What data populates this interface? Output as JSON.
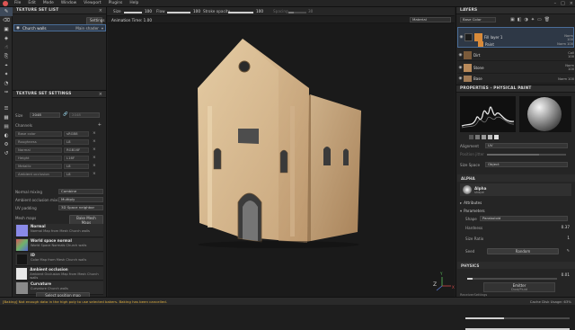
{
  "menubar": {
    "items": [
      "File",
      "Edit",
      "Mode",
      "Window",
      "Viewport",
      "Plugins",
      "Help"
    ]
  },
  "context_bar": {
    "size_label": "Size",
    "size_value": "100",
    "flow_label": "Flow",
    "flow_value": "100",
    "stroke_label": "Stroke opacity",
    "stroke_value": "100",
    "spacing_label": "Spacing",
    "spacing_value": "30"
  },
  "viewport": {
    "header_left": "Animation Time: 1.00",
    "material_mode": "Material",
    "gizmo_z": "Z",
    "gizmo_x": "X",
    "gizmo_y": "Y"
  },
  "texture_set_list": {
    "title": "TEXTURE SET LIST",
    "settings_label": "Settings",
    "item_name": "Church walls",
    "item_shader": "Main shader"
  },
  "texture_set_settings": {
    "title": "TEXTURE SET SETTINGS",
    "size_label": "Size",
    "size_value": "2048",
    "size_linked": "2048",
    "channels_label": "Channels",
    "channels": [
      {
        "name": "Base color",
        "format": "sRGB8"
      },
      {
        "name": "Roughness",
        "format": "L8"
      },
      {
        "name": "Normal",
        "format": "RGB16F"
      },
      {
        "name": "Height",
        "format": "L16F"
      },
      {
        "name": "Metallic",
        "format": "L8"
      },
      {
        "name": "Ambient occlusion",
        "format": "L8"
      }
    ],
    "normal_mixing_label": "Normal mixing",
    "normal_mixing_value": "Combine",
    "ao_mixing_label": "Ambient occlusion mixing",
    "ao_mixing_value": "Multiply",
    "uv_padding_label": "UV padding",
    "uv_padding_value": "3D Space neighbor",
    "mesh_maps_label": "Mesh maps",
    "bake_button": "Bake Mesh Maps",
    "mesh_maps": [
      {
        "title": "Normal",
        "desc": "Normal Map from Mesh Church walls",
        "color": "#8a8ae8"
      },
      {
        "title": "World space normal",
        "desc": "World Space Normals Church walls",
        "color": "#6fb36b"
      },
      {
        "title": "ID",
        "desc": "Color Map from Mesh Church walls",
        "color": "#2a2a2a"
      },
      {
        "title": "Ambient occlusion",
        "desc": "Ambient Occlusion Map from Mesh Church walls",
        "color": "#e8e8e8"
      },
      {
        "title": "Curvature",
        "desc": "Curvature Church walls",
        "color": "#8a8a8a"
      }
    ],
    "select_button": "Select position map"
  },
  "layers": {
    "title": "LAYERS",
    "channel_select": "Base Color",
    "items": [
      {
        "name": "Fill layer 1",
        "blend": "Norm",
        "opacity": "100",
        "color": "#1d1d1d",
        "selected": true
      },
      {
        "name": "Paint",
        "blend": "Norm",
        "opacity": "100",
        "color": "#d88a3a",
        "selected": false
      },
      {
        "name": "Dirt",
        "blend": "Coll",
        "opacity": "100",
        "color": "#7a5a3a",
        "selected": false
      },
      {
        "name": "Stone",
        "blend": "Norm",
        "opacity": "100",
        "color": "#b98a5a",
        "selected": false
      },
      {
        "name": "Base",
        "blend": "Norm",
        "opacity": "100",
        "color": "#a07a55",
        "selected": false
      }
    ]
  },
  "properties": {
    "title": "PROPERTIES - PHYSICAL PAINT",
    "alignment_label": "Alignment",
    "alignment_value": "UV",
    "position_label": "Position jitter",
    "size_space_label": "Size Space",
    "size_space_value": "Object",
    "alpha_section": "ALPHA",
    "alpha_name": "Alpha",
    "alpha_sub": "shape",
    "attributes_label": "Attributes",
    "parameters_label": "Parameters",
    "shape_label": "Shape",
    "shape_value": "Paraboloid",
    "hardness_label": "Hardness",
    "hardness_value": "0.37",
    "size_ratio_label": "Size Ratio",
    "size_ratio_value": "1",
    "seed_label": "Seed",
    "seed_value": "Random",
    "physics_section": "PHYSICS",
    "physics_value": "0.01",
    "emitter_label": "Emitter",
    "emitter_sub": "Dust/Fluid",
    "receiver_label": "ReceiverSettings"
  },
  "statusbar": {
    "message": "[Baking] Not enough data in the high poly to use selected bakers. Baking has been cancelled.",
    "right": "Cache Disk Usage: 63%"
  },
  "colors": {
    "accent": "#4a6d98",
    "warning": "#e0b040",
    "wall": "#d2b58f"
  }
}
